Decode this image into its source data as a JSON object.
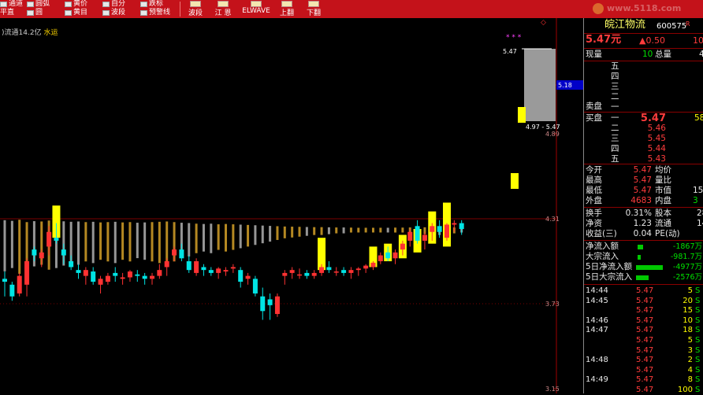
{
  "toolbar": {
    "left_items": [
      {
        "top": "通道",
        "bottom": "平直"
      },
      {
        "top": "圆弧",
        "bottom": "圆"
      },
      {
        "top": "黄价",
        "bottom": "黄目"
      },
      {
        "top": "自分",
        "bottom": "波段"
      },
      {
        "top": "跌标",
        "bottom": "预警线"
      }
    ],
    "buttons": [
      "波段",
      "江 恩",
      "ELWAVE",
      "上翻",
      "下翻"
    ],
    "watermark": "www.5118.com"
  },
  "header": {
    "prefix": ")流通",
    "float_shares": "14.2亿",
    "sector": "水运"
  },
  "price_axis": [
    "5.18",
    "4.89",
    "4.31",
    "3.73",
    "3.15"
  ],
  "chart_annotations": {
    "stars": "* * *",
    "range_top": "5.47",
    "range_label": "4.97 - 5.47",
    "diamond": "◇"
  },
  "quote": {
    "name": "皖江物流",
    "code": "600575",
    "suffix": "R",
    "price": "5.47元",
    "change": "▲0.50",
    "change_pct": "10",
    "labels": {
      "xianliang": "现量",
      "zongliang": "总量",
      "maipan": "卖盘",
      "mairu": "买盘"
    },
    "xianliang": "10",
    "zongliang": "4",
    "sell": [
      {
        "level": "五",
        "price": "",
        "vol": ""
      },
      {
        "level": "四",
        "price": "",
        "vol": ""
      },
      {
        "level": "三",
        "price": "",
        "vol": ""
      },
      {
        "level": "二",
        "price": "",
        "vol": ""
      },
      {
        "level": "一",
        "price": "",
        "vol": ""
      }
    ],
    "buy": [
      {
        "level": "一",
        "price": "5.47",
        "vol": "58"
      },
      {
        "level": "二",
        "price": "5.46",
        "vol": ""
      },
      {
        "level": "三",
        "price": "5.45",
        "vol": ""
      },
      {
        "level": "四",
        "price": "5.44",
        "vol": ""
      },
      {
        "level": "五",
        "price": "5.43",
        "vol": ""
      }
    ],
    "stats_left": [
      {
        "label": "今开",
        "value": "5.47"
      },
      {
        "label": "最高",
        "value": "5.47"
      },
      {
        "label": "最低",
        "value": "5.47"
      },
      {
        "label": "外盘",
        "value": "4683"
      }
    ],
    "stats_right": [
      {
        "label": "均价",
        "value": ""
      },
      {
        "label": "量比",
        "value": ""
      },
      {
        "label": "市值",
        "value": "15"
      },
      {
        "label": "内盘",
        "value": "3"
      }
    ],
    "stats2_left": [
      {
        "label": "换手",
        "value": "0.31%"
      },
      {
        "label": "净资",
        "value": "1.23"
      },
      {
        "label": "收益(三)",
        "value": "0.04"
      }
    ],
    "stats2_right": [
      {
        "label": "股本",
        "value": "28"
      },
      {
        "label": "流通",
        "value": "14"
      },
      {
        "label": "PE(动)",
        "value": ""
      }
    ],
    "flows": [
      {
        "label": "净流入额",
        "value": "-1867万",
        "bar": 0.18
      },
      {
        "label": "大宗流入",
        "value": "-981.7万",
        "bar": 0.1
      },
      {
        "label": "5日净流入额",
        "value": "-4977万",
        "bar": 0.85
      },
      {
        "label": "5日大宗流入",
        "value": "-2576万",
        "bar": 0.4
      }
    ],
    "ticks": [
      {
        "time": "14:44",
        "price": "5.47",
        "vol": "5",
        "bs": "S"
      },
      {
        "time": "14:45",
        "price": "5.47",
        "vol": "20",
        "bs": "S"
      },
      {
        "time": "",
        "price": "5.47",
        "vol": "15",
        "bs": "S"
      },
      {
        "time": "14:46",
        "price": "5.47",
        "vol": "10",
        "bs": "S"
      },
      {
        "time": "14:47",
        "price": "5.47",
        "vol": "18",
        "bs": "S"
      },
      {
        "time": "",
        "price": "5.47",
        "vol": "5",
        "bs": "S"
      },
      {
        "time": "",
        "price": "5.47",
        "vol": "3",
        "bs": "S"
      },
      {
        "time": "14:48",
        "price": "5.47",
        "vol": "2",
        "bs": "S"
      },
      {
        "time": "",
        "price": "5.47",
        "vol": "4",
        "bs": "S"
      },
      {
        "time": "14:49",
        "price": "5.47",
        "vol": "8",
        "bs": "S"
      },
      {
        "time": "",
        "price": "5.47",
        "vol": "100",
        "bs": "S"
      }
    ]
  },
  "chart_data": {
    "type": "candlestick",
    "ylim": [
      3.15,
      5.5
    ],
    "candles": [
      [
        3.9,
        3.95,
        3.78,
        3.88
      ],
      [
        3.86,
        3.88,
        3.75,
        3.78
      ],
      [
        3.8,
        3.94,
        3.78,
        3.92
      ],
      [
        3.86,
        4.04,
        3.78,
        4.02
      ],
      [
        4.1,
        4.12,
        4.02,
        4.06
      ],
      [
        4.04,
        4.1,
        3.98,
        4.08
      ],
      [
        4.12,
        4.26,
        4.06,
        4.22
      ],
      [
        4.18,
        4.28,
        4.14,
        4.16
      ],
      [
        4.1,
        4.14,
        4.0,
        4.06
      ],
      [
        4.02,
        4.06,
        3.96,
        3.98
      ],
      [
        3.96,
        4.0,
        3.9,
        3.94
      ],
      [
        3.92,
        3.98,
        3.86,
        3.96
      ],
      [
        3.95,
        3.98,
        3.86,
        3.88
      ],
      [
        3.86,
        3.92,
        3.8,
        3.9
      ],
      [
        3.88,
        3.94,
        3.86,
        3.92
      ],
      [
        3.94,
        3.98,
        3.88,
        3.92
      ],
      [
        3.9,
        3.94,
        3.86,
        3.91
      ],
      [
        3.91,
        3.96,
        3.88,
        3.95
      ],
      [
        3.93,
        3.96,
        3.88,
        3.92
      ],
      [
        3.92,
        3.94,
        3.86,
        3.9
      ],
      [
        3.9,
        3.94,
        3.86,
        3.92
      ],
      [
        3.92,
        4.0,
        3.9,
        3.96
      ],
      [
        3.98,
        4.04,
        3.92,
        4.02
      ],
      [
        4.06,
        4.12,
        4.02,
        4.1
      ],
      [
        4.1,
        4.14,
        4.02,
        4.04
      ],
      [
        4.02,
        4.06,
        3.94,
        3.96
      ],
      [
        3.94,
        4.04,
        3.92,
        4.02
      ],
      [
        3.98,
        4.0,
        3.92,
        3.96
      ],
      [
        3.96,
        3.98,
        3.92,
        3.94
      ],
      [
        3.94,
        3.98,
        3.9,
        3.97
      ],
      [
        3.95,
        3.98,
        3.92,
        3.96
      ],
      [
        3.97,
        4.0,
        3.94,
        3.98
      ],
      [
        3.96,
        3.98,
        3.84,
        3.88
      ],
      [
        3.9,
        3.94,
        3.86,
        3.92
      ],
      [
        3.9,
        3.92,
        3.78,
        3.8
      ],
      [
        3.78,
        3.84,
        3.62,
        3.68
      ],
      [
        3.76,
        3.8,
        3.62,
        3.72
      ],
      [
        3.66,
        3.8,
        3.64,
        3.78
      ],
      [
        3.92,
        3.96,
        3.86,
        3.94
      ],
      [
        3.94,
        3.98,
        3.9,
        3.96
      ],
      [
        3.93,
        3.97,
        3.9,
        3.93
      ],
      [
        3.94,
        3.96,
        3.9,
        3.92
      ],
      [
        3.92,
        3.96,
        3.9,
        3.94
      ],
      [
        3.94,
        4.0,
        3.92,
        3.98
      ],
      [
        3.98,
        4.02,
        3.94,
        3.96
      ],
      [
        3.95,
        3.98,
        3.92,
        3.95
      ],
      [
        3.96,
        3.98,
        3.92,
        3.94
      ],
      [
        3.94,
        3.98,
        3.9,
        3.96
      ],
      [
        3.96,
        3.98,
        3.92,
        3.97
      ],
      [
        3.97,
        4.0,
        3.94,
        3.99
      ],
      [
        3.98,
        4.02,
        3.96,
        4.01
      ],
      [
        4.02,
        4.08,
        4.0,
        4.06
      ],
      [
        4.08,
        4.12,
        4.02,
        4.04
      ],
      [
        4.04,
        4.1,
        4.0,
        4.08
      ],
      [
        4.1,
        4.16,
        4.06,
        4.14
      ],
      [
        4.16,
        4.24,
        4.12,
        4.22
      ],
      [
        4.26,
        4.3,
        4.14,
        4.16
      ],
      [
        4.16,
        4.22,
        4.1,
        4.2
      ],
      [
        4.22,
        4.28,
        4.16,
        4.26
      ],
      [
        4.26,
        4.3,
        4.18,
        4.22
      ],
      [
        4.18,
        4.28,
        4.16,
        4.27
      ],
      [
        4.27,
        4.3,
        4.22,
        4.28
      ],
      [
        4.28,
        4.3,
        4.2,
        4.24
      ]
    ],
    "volume": [
      52,
      48,
      55,
      40,
      46,
      44,
      50,
      48,
      45,
      42,
      44,
      40,
      42,
      38,
      40,
      42,
      38,
      40,
      36,
      38,
      40,
      42,
      44,
      40,
      36,
      34,
      30,
      28,
      30,
      26,
      28,
      26,
      24,
      22,
      20,
      18,
      16,
      14,
      12,
      11,
      10,
      9,
      8,
      8,
      7,
      6,
      6,
      5,
      4,
      4,
      4,
      4,
      4,
      5,
      5,
      6,
      6,
      7,
      8,
      8,
      7,
      6,
      5
    ],
    "signal_blocks": [
      {
        "i": 7,
        "top": 4.4,
        "bottom": 4.18
      },
      {
        "i": 43,
        "top": 4.18,
        "bottom": 3.96
      },
      {
        "i": 50,
        "top": 4.12,
        "bottom": 3.98
      },
      {
        "i": 52,
        "top": 4.14,
        "bottom": 4.02
      },
      {
        "i": 54,
        "top": 4.2,
        "bottom": 4.04
      },
      {
        "i": 56,
        "top": 4.24,
        "bottom": 4.08
      },
      {
        "i": 58,
        "top": 4.36,
        "bottom": 4.14
      },
      {
        "i": 60,
        "top": 4.42,
        "bottom": 4.12
      }
    ],
    "right_blocks": [
      {
        "x": 4.89,
        "top": 4.89,
        "bottom": 4.8
      },
      {
        "x": 4.67,
        "top": 4.67,
        "bottom": 4.6
      }
    ]
  }
}
